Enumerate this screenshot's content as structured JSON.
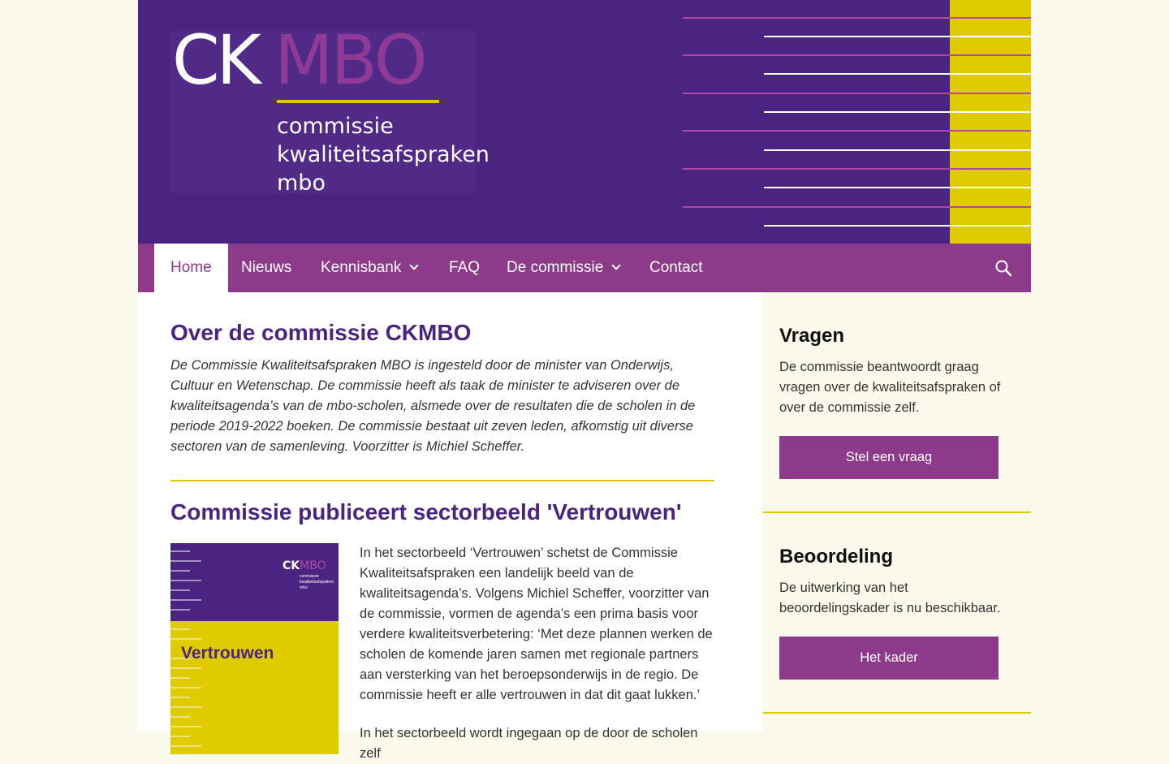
{
  "header": {
    "logo": {
      "ck": "CK",
      "mbo": "MBO",
      "lines": [
        "commissie",
        "kwaliteitsafspraken",
        "mbo"
      ]
    }
  },
  "nav": {
    "items": [
      {
        "label": "Home",
        "active": true
      },
      {
        "label": "Nieuws"
      },
      {
        "label": "Kennisbank",
        "dropdown": true
      },
      {
        "label": "FAQ"
      },
      {
        "label": "De commissie",
        "dropdown": true
      },
      {
        "label": "Contact"
      }
    ],
    "search_icon": "search-icon"
  },
  "main": {
    "title": "Over de commissie CKMBO",
    "intro": "De Commissie Kwaliteitsafspraken MBO is ingesteld door de minister van Onderwijs, Cultuur en Wetenschap. De commissie heeft als taak de minister te adviseren over de kwaliteitsagenda’s van de mbo-scholen, alsmede over de resultaten die de scholen in de periode 2019-2022 boeken. De commissie bestaat uit zeven leden, afkomstig uit diverse sectoren van de samenleving. Voorzitter is Michiel Scheffer.",
    "article": {
      "title": "Commissie publiceert sectorbeeld 'Vertrouwen'",
      "cover": {
        "ck": "CK",
        "mbo": "MBO",
        "sub": [
          "commissie",
          "kwaliteitsafspraken",
          "mbo"
        ],
        "title": "Vertrouwen"
      },
      "paragraphs": [
        "In het sectorbeeld ‘Vertrouwen’ schetst de Commissie Kwaliteitsafspraken een landelijk beeld van de kwaliteitsagenda’s. Volgens Michiel Scheffer, voorzitter van de commissie, vormen de agenda’s een prima basis voor verdere kwaliteitsverbetering: ‘Met deze plannen werken de scholen de komende jaren samen met regionale partners aan versterking van het beroepsonderwijs in de regio. De commissie heeft er alle vertrouwen in dat dit gaat lukken.’",
        "In het sectorbeeld wordt ingegaan op de door de scholen zelf"
      ]
    }
  },
  "sidebar": {
    "widgets": [
      {
        "title": "Vragen",
        "text": "De commissie beantwoordt graag vragen over de kwaliteitsafspraken of over de commissie zelf.",
        "button": "Stel een vraag"
      },
      {
        "title": "Beoordeling",
        "text": "De uitwerking van het beoordelingskader is nu beschikbaar.",
        "button": "Het kader"
      }
    ]
  },
  "colors": {
    "purple": "#4a2480",
    "magenta": "#8e3a8a",
    "yellow": "#e0c800",
    "cream": "#fbf9ec"
  }
}
